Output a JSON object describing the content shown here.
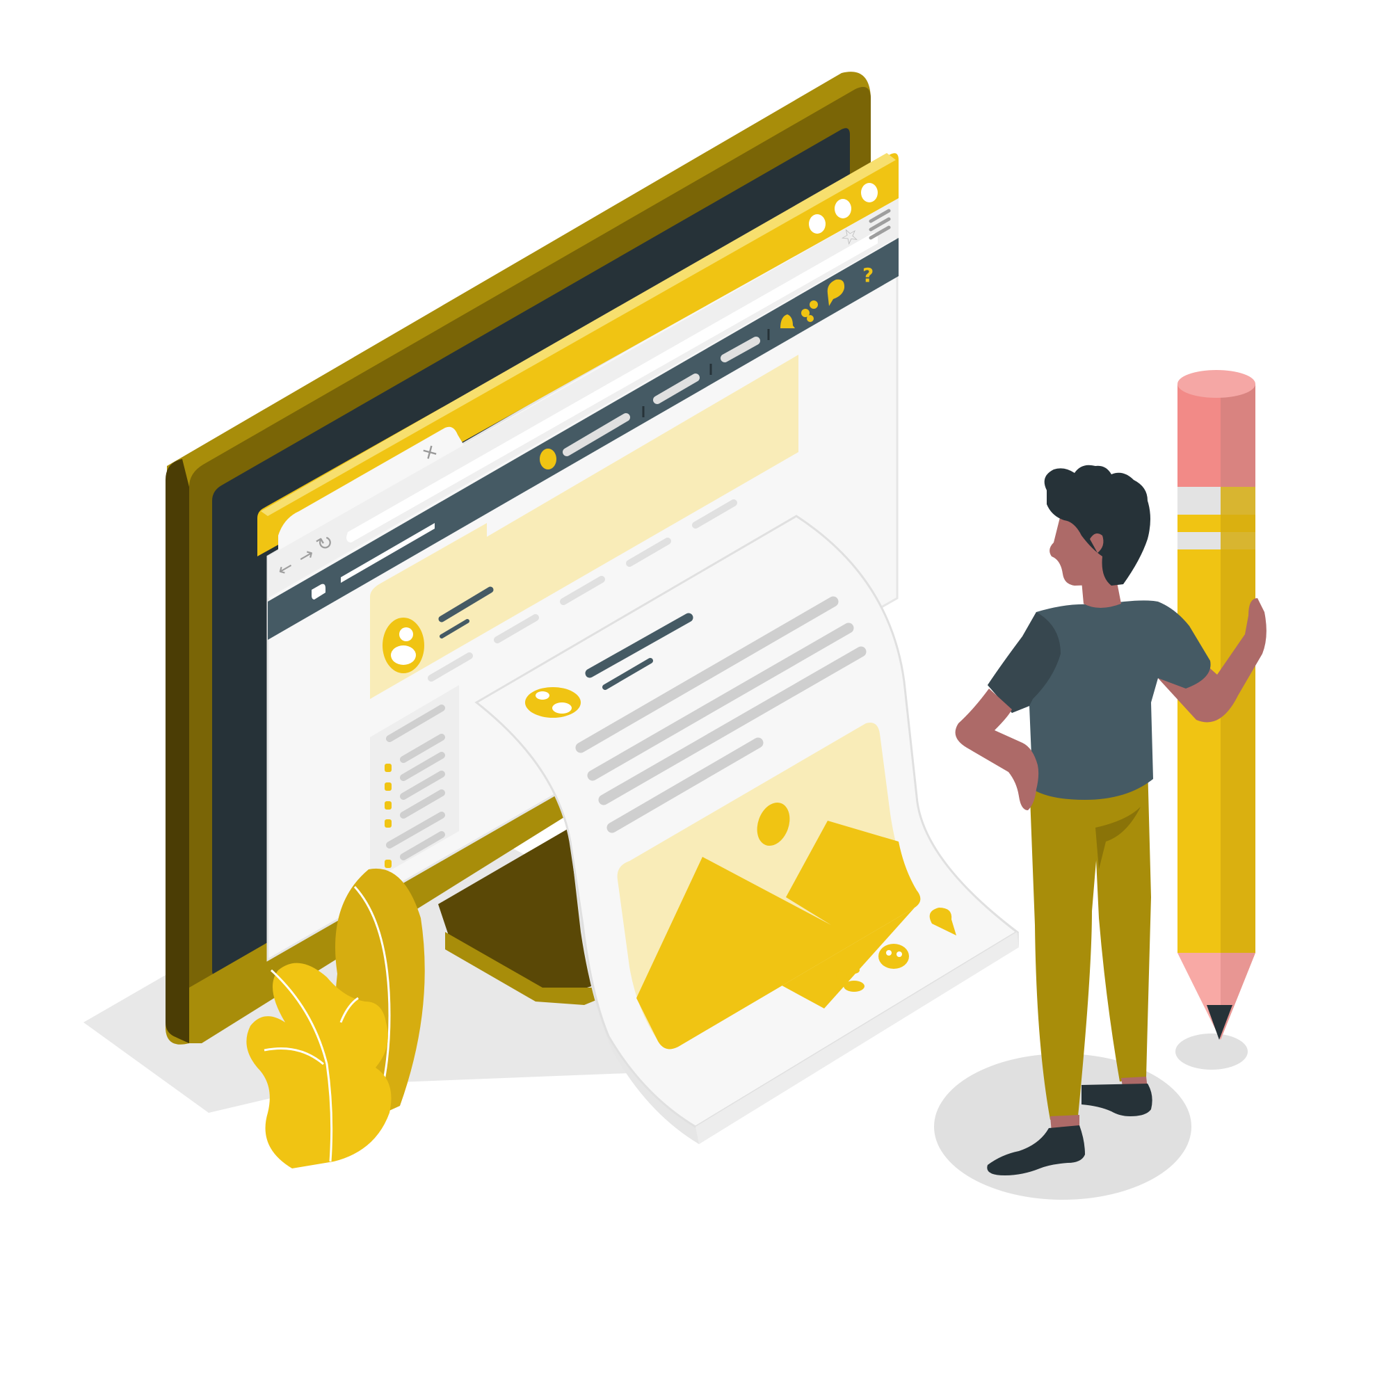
{
  "colors": {
    "accent": "#F0C413",
    "accent_dark": "#A88D0A",
    "monitor_dark": "#7A6506",
    "monitor_darker": "#4B3D05",
    "screen": "#263238",
    "nav_bar": "#455A64",
    "page_bg": "#F7F7F7",
    "placeholder_line": "#CFCFCF",
    "highlight_bg": "#F9ECB8",
    "skin": "#AD6A68",
    "shirt": "#455A64",
    "pants": "#A88D0A",
    "shoes": "#263238",
    "pencil_eraser": "#F28A87",
    "shadow": "#E0E0E0"
  },
  "browser": {
    "tab_close_glyph": "×",
    "nav_back_glyph": "←",
    "nav_forward_glyph": "→",
    "reload_glyph": "↻",
    "search_glyph": "a",
    "star_glyph": "☆",
    "help_glyph": "?"
  },
  "icons": [
    "close-icon",
    "back-arrow-icon",
    "forward-arrow-icon",
    "reload-icon",
    "search-icon",
    "star-icon",
    "menu-icon",
    "bell-icon",
    "users-icon",
    "chat-icon",
    "help-icon",
    "user-avatar-icon",
    "image-icon",
    "emoji-icon",
    "location-pin-icon"
  ]
}
